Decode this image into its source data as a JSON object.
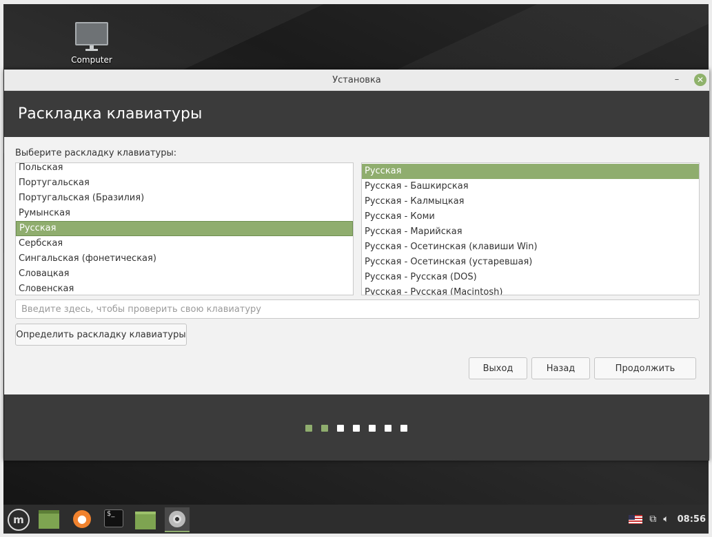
{
  "desktop": {
    "icon_label": "Computer"
  },
  "window": {
    "title": "Установка",
    "minimize_label": "–",
    "close_label": "✕",
    "header": "Раскладка клавиатуры",
    "prompt": "Выберите раскладку клавиатуры:",
    "layouts": [
      "Польская",
      "Португальская",
      "Португальская (Бразилия)",
      "Румынская",
      "Русская",
      "Сербская",
      "Сингальская (фонетическая)",
      "Словацкая",
      "Словенская"
    ],
    "layouts_selected": "Русская",
    "variants": [
      "Русская",
      "Русская - Башкирская",
      "Русская - Калмыцкая",
      "Русская - Коми",
      "Русская - Марийская",
      "Русская - Осетинская (клавиши Win)",
      "Русская - Осетинская (устаревшая)",
      "Русская - Русская (DOS)",
      "Русская - Русская (Macintosh)"
    ],
    "variants_selected": "Русская",
    "test_placeholder": "Введите здесь, чтобы проверить свою клавиатуру",
    "detect_button": "Определить раскладку клавиатуры",
    "quit_button": "Выход",
    "back_button": "Назад",
    "continue_button": "Продолжить",
    "progress": {
      "total_steps": 7,
      "completed_steps": 2
    }
  },
  "taskbar": {
    "menu_icon": "mint-logo-icon",
    "items": [
      "show-desktop-icon",
      "firefox-icon",
      "terminal-icon",
      "files-icon",
      "disc-installer-icon"
    ],
    "terminal_glyph": "$_",
    "clock": "08:56",
    "tray_icons": [
      "us-flag-icon",
      "network-icon",
      "volume-icon"
    ]
  },
  "colors": {
    "accent": "#8fad6e",
    "header_bg": "#3b3b3b",
    "taskbar_bg": "#2d2d2d"
  }
}
